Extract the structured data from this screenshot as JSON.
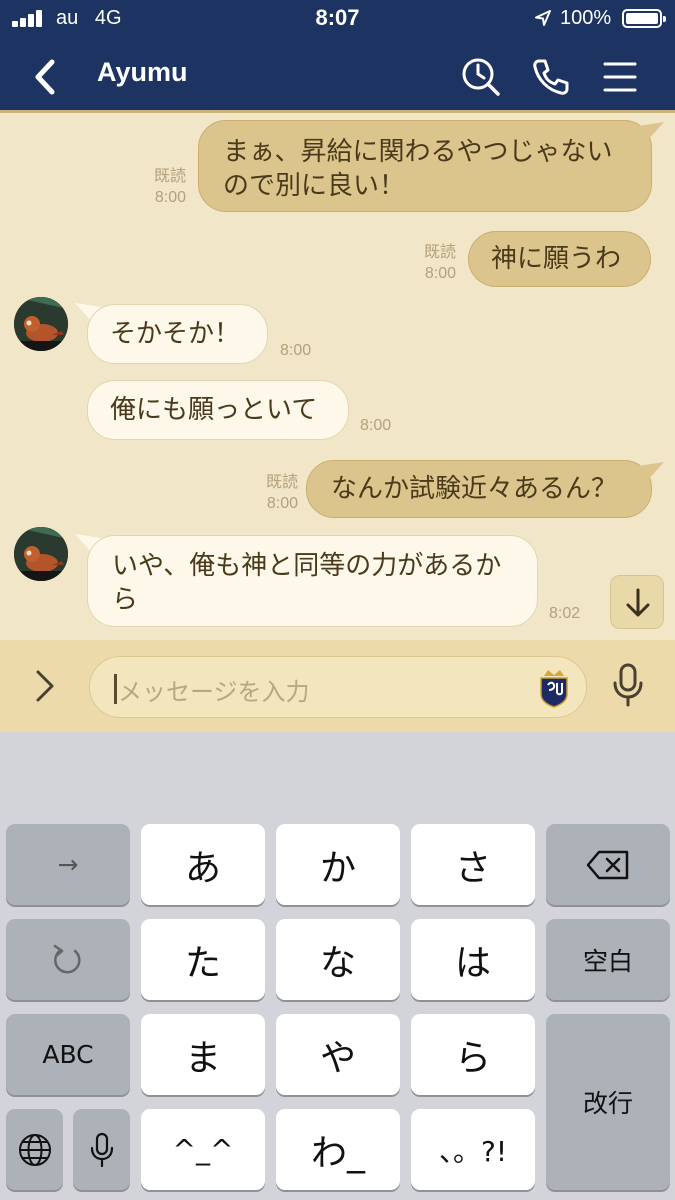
{
  "status_bar": {
    "carrier": "au",
    "network": "4G",
    "time": "8:07",
    "battery": "100%"
  },
  "header": {
    "title": "Ayumu",
    "back_icon": "chevron-left-icon",
    "search_icon": "search-clock-icon",
    "call_icon": "phone-icon",
    "menu_icon": "hamburger-menu-icon"
  },
  "messages": [
    {
      "side": "sent",
      "text_lines": [
        "まぁ、昇給に関わるやつじゃない",
        "ので別に良い！"
      ],
      "read": "既読",
      "time": "8:00"
    },
    {
      "side": "sent",
      "text_lines": [
        "神に願うわ"
      ],
      "read": "既読",
      "time": "8:00"
    },
    {
      "side": "received",
      "text_lines": [
        "そかそか！"
      ],
      "time": "8:00"
    },
    {
      "side": "received",
      "text_lines": [
        "俺にも願っといて"
      ],
      "time": "8:00"
    },
    {
      "side": "sent",
      "text_lines": [
        "なんか試験近々あるん？"
      ],
      "read": "既読",
      "time": "8:00"
    },
    {
      "side": "received",
      "text_lines": [
        "いや、俺も神と同等の力があるか",
        "ら"
      ],
      "time": "8:02"
    }
  ],
  "input": {
    "placeholder": "メッセージを入力"
  },
  "keyboard": {
    "keys": {
      "arrow": "→",
      "a": "あ",
      "ka": "か",
      "sa": "さ",
      "undo": "",
      "ta": "た",
      "na": "な",
      "ha": "は",
      "space": "空白",
      "abc": "ABC",
      "ma": "ま",
      "ya": "や",
      "ra": "ら",
      "enter": "改行",
      "kaomoji": "^_^",
      "wa": "わ_",
      "punct": "、。?!"
    }
  },
  "colors": {
    "header_bg": "#1d3462",
    "chat_bg": "#f2e6c8",
    "sent_bubble": "#dcc58d",
    "received_bubble": "#fdf8ea",
    "keyboard_bg": "#d2d4d9"
  }
}
